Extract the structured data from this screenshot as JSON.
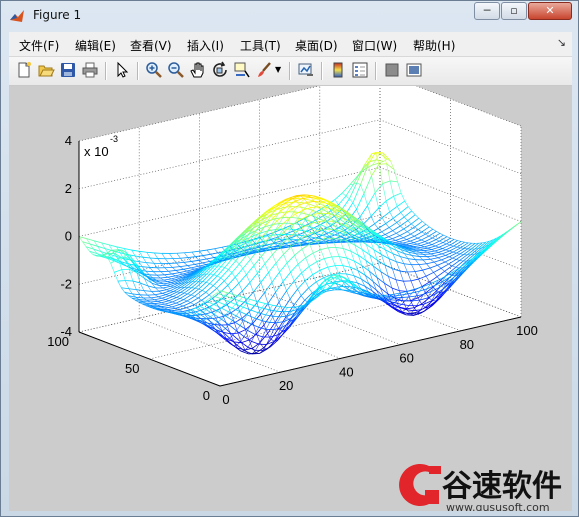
{
  "window": {
    "title": "Figure 1",
    "controls": {
      "minimize": "─",
      "maximize": "▫",
      "close": "✕"
    }
  },
  "menu": {
    "items": [
      {
        "label": "文件(F)"
      },
      {
        "label": "编辑(E)"
      },
      {
        "label": "查看(V)"
      },
      {
        "label": "插入(I)"
      },
      {
        "label": "工具(T)"
      },
      {
        "label": "桌面(D)"
      },
      {
        "label": "窗口(W)"
      },
      {
        "label": "帮助(H)"
      }
    ],
    "dock_glyph": "↘"
  },
  "toolbar": {
    "icons": [
      "new-figure-icon",
      "open-file-icon",
      "save-icon",
      "print-icon",
      "select-arrow-icon",
      "zoom-in-icon",
      "zoom-out-icon",
      "pan-hand-icon",
      "rotate-3d-icon",
      "data-cursor-icon",
      "brush-icon",
      "link-plot-icon",
      "colorbar-icon",
      "legend-icon",
      "hide-plot-tools-icon",
      "show-plot-tools-icon"
    ]
  },
  "plot": {
    "exponent_label": "x 10",
    "exponent_power": "-3",
    "z_ticks": [
      "4",
      "2",
      "0",
      "-2",
      "-4"
    ],
    "y_ticks": [
      "100",
      "50",
      "0"
    ],
    "x_ticks": [
      "0",
      "20",
      "40",
      "60",
      "80",
      "100"
    ],
    "colors": {
      "background": "#cccccc",
      "axes": "#ffffff",
      "grid": "#444444"
    }
  },
  "chart_data": {
    "type": "surface-mesh",
    "title": "",
    "xlabel": "",
    "ylabel": "",
    "zlabel": "",
    "xlim": [
      0,
      100
    ],
    "ylim": [
      0,
      100
    ],
    "zlim": [
      -4,
      4
    ],
    "z_scale_exponent": -3,
    "x_ticks": [
      0,
      20,
      40,
      60,
      80,
      100
    ],
    "y_ticks": [
      0,
      50,
      100
    ],
    "z_ticks": [
      -4,
      -2,
      0,
      2,
      4
    ],
    "grid": true,
    "colormap": "jet"
  },
  "watermark": {
    "text": "谷速软件",
    "url": "www.gususoft.com"
  }
}
